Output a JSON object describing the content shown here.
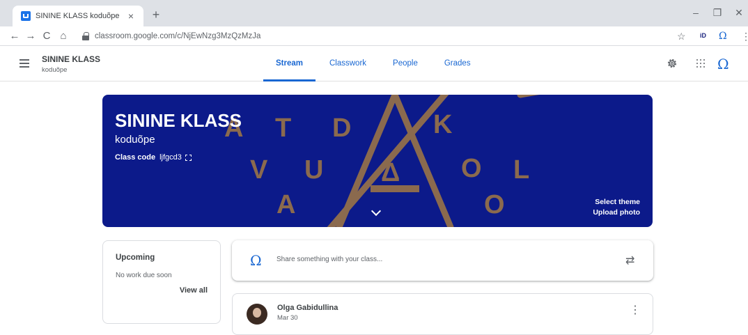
{
  "browser": {
    "tab_title": "SININE KLASS koduõpe",
    "tab_close": "×",
    "new_tab": "+",
    "url": "classroom.google.com/c/NjEwNzg3MzQzMzJa",
    "back": "←",
    "forward": "→",
    "reload": "C",
    "home": "⌂",
    "bookmark": "☆",
    "ext_label": "iD",
    "more": "⋮",
    "minimize": "–",
    "restore": "❐",
    "close": "✕"
  },
  "header": {
    "class_name": "SININE KLASS",
    "class_sub": "koduõpe",
    "tabs": [
      {
        "label": "Stream"
      },
      {
        "label": "Classwork"
      },
      {
        "label": "People"
      },
      {
        "label": "Grades"
      }
    ],
    "avatar_glyph": "Ω"
  },
  "banner": {
    "title": "SININE KLASS",
    "subtitle": "koduõpe",
    "class_code_label": "Class code",
    "class_code": "ljfgcd3",
    "select_theme": "Select theme",
    "upload_photo": "Upload photo",
    "bg_color": "#0c1a8a",
    "letter_color": "#8b6a4e",
    "letters": [
      "A",
      "T",
      "D",
      "K",
      "V",
      "U",
      "Δ",
      "O",
      "L",
      "A",
      "O"
    ]
  },
  "upcoming": {
    "title": "Upcoming",
    "empty": "No work due soon",
    "view_all": "View all"
  },
  "share": {
    "placeholder": "Share something with your class...",
    "avatar_glyph": "Ω",
    "repost_glyph": "⇄"
  },
  "post": {
    "author": "Olga Gabidullina",
    "date": "Mar 30",
    "more_glyph": "⋮"
  }
}
